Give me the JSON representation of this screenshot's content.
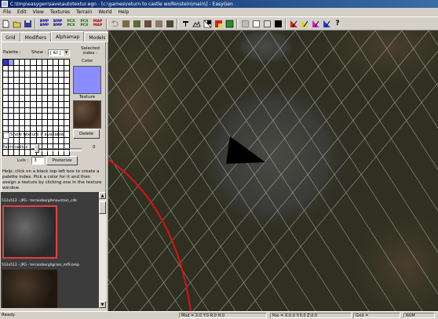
{
  "window": {
    "title": "C:\\tmp\\easygen\\save\\autotextur.egn - [c:\\games\\return to castle wolfenstein\\main\\] - EasyGen"
  },
  "menu": [
    "File",
    "Edit",
    "View",
    "Textures",
    "Terrain",
    "World",
    "Help"
  ],
  "toolbar": {
    "bmp1": [
      "BMP",
      "BMP"
    ],
    "bmp2": [
      "BMP",
      "BMP"
    ],
    "pcx1": [
      "PCX",
      "PCX"
    ],
    "pcx2": [
      "PCX",
      "PCX"
    ],
    "map": [
      "MAP",
      "MAP"
    ],
    "help": "?"
  },
  "tabs": [
    "Grid",
    "Modifiers",
    "Alphamap",
    "Models"
  ],
  "alphamap": {
    "palette_label": "Palette :",
    "show_label": "Show :",
    "show_value": "[ All ]",
    "selected_index_label": "Selected index :",
    "color_label": "Color",
    "texture_label": "Texture",
    "show_texture_label": "Show texture if available",
    "delete_label": "Delete",
    "paint_radius_label": "Paint radius :",
    "paint_radius_value": "0",
    "lvls_label": "Lvls :",
    "lvls_value": "3",
    "posterize_label": "Posterize",
    "help_text": "Help: click on a black top-left box to create a palette index. Pick a color for it and then assign a texture by clicking one in the texture window.",
    "palette_colors": {
      "c0": "#3333cc",
      "c1": "#9999ff",
      "c2": "#ffffff"
    }
  },
  "texture_list": [
    {
      "label": "512x512 - JPG - terrainbergl\\mountain_c4k"
    },
    {
      "label": "512x512 - JPG - terrainbergl\\grass_mf9.bmp"
    }
  ],
  "status": {
    "ready": "Ready",
    "mod": "Mod = X:0 Y:0 R:0 H:0",
    "pos": "Pos = X:0.0 Y:0.0 Z:0.0",
    "grid": "Grid =",
    "num": "NUM"
  },
  "colors": {
    "viewport_bg": "#2f2f22",
    "grid_line": "#c8c8c8",
    "red_curve": "#e01010",
    "title_blue": "#0a246a"
  }
}
